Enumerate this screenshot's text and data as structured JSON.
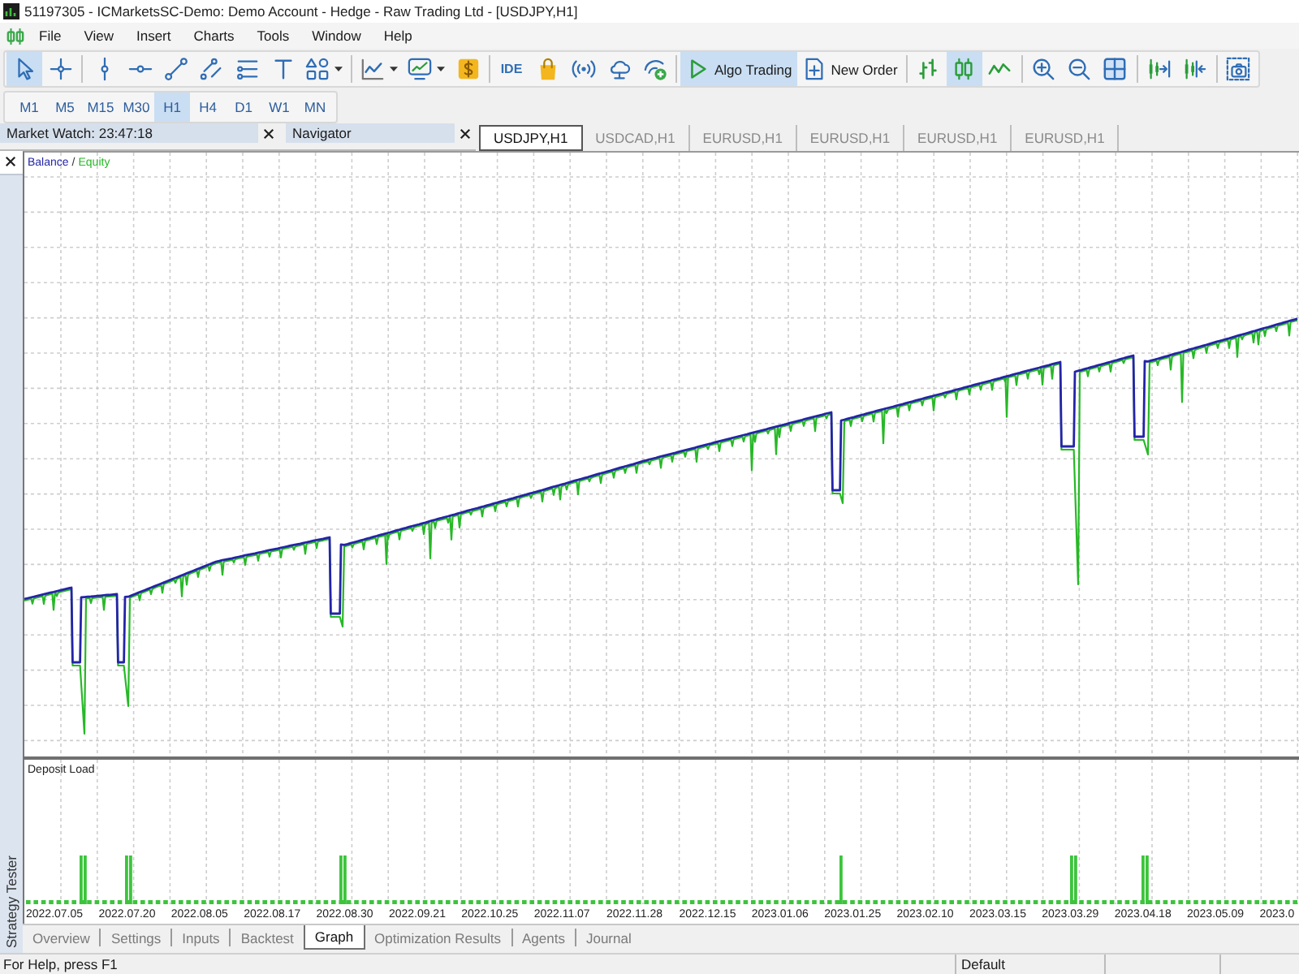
{
  "window": {
    "title": "51197305 - ICMarketsSC-Demo: Demo Account - Hedge - Raw Trading Ltd - [USDJPY,H1]"
  },
  "menu": [
    "File",
    "View",
    "Insert",
    "Charts",
    "Tools",
    "Window",
    "Help"
  ],
  "toolbar": [
    [
      {
        "kind": "icon",
        "on": true
      },
      {
        "kind": "icon",
        "on": false
      }
    ],
    [
      {
        "kind": "icon",
        "on": false
      },
      {
        "kind": "icon",
        "on": false
      },
      {
        "kind": "icon",
        "on": false
      },
      {
        "kind": "icon",
        "on": false
      },
      {
        "kind": "icon",
        "on": false
      },
      {
        "kind": "icon",
        "on": false
      },
      {
        "kind": "icon-menu",
        "on": false
      }
    ],
    [
      {
        "kind": "icon-menu",
        "on": false
      },
      {
        "kind": "icon-menu",
        "on": false
      },
      {
        "kind": "icon",
        "on": false
      }
    ],
    [
      {
        "kind": "text",
        "label": "IDE",
        "on": false
      },
      {
        "kind": "icon",
        "on": false
      },
      {
        "kind": "icon",
        "on": false
      },
      {
        "kind": "icon",
        "on": false
      },
      {
        "kind": "icon",
        "on": false
      }
    ],
    [
      {
        "kind": "icon-text",
        "label": "Algo Trading",
        "on": true
      },
      {
        "kind": "icon-text",
        "label": "New Order",
        "on": false
      }
    ],
    [
      {
        "kind": "icon",
        "on": false
      },
      {
        "kind": "icon",
        "on": true
      },
      {
        "kind": "icon",
        "on": false
      }
    ],
    [
      {
        "kind": "icon",
        "on": false
      },
      {
        "kind": "icon",
        "on": false
      },
      {
        "kind": "icon",
        "on": false
      }
    ],
    [
      {
        "kind": "icon",
        "on": false
      },
      {
        "kind": "icon",
        "on": false
      }
    ],
    [
      {
        "kind": "icon",
        "on": false
      }
    ]
  ],
  "timeframes": [
    {
      "label": "M1",
      "selected": false
    },
    {
      "label": "M5",
      "selected": false
    },
    {
      "label": "M15",
      "selected": false
    },
    {
      "label": "M30",
      "selected": false
    },
    {
      "label": "H1",
      "selected": true
    },
    {
      "label": "H4",
      "selected": false
    },
    {
      "label": "D1",
      "selected": false
    },
    {
      "label": "W1",
      "selected": false
    },
    {
      "label": "MN",
      "selected": false
    }
  ],
  "panels": [
    {
      "title": "Market Watch: 23:47:18"
    },
    {
      "title": "Navigator"
    }
  ],
  "chart_tabs": [
    {
      "label": "USDJPY,H1",
      "selected": true
    },
    {
      "label": "USDCAD,H1",
      "selected": false
    },
    {
      "label": "EURUSD,H1",
      "selected": false
    },
    {
      "label": "EURUSD,H1",
      "selected": false
    },
    {
      "label": "EURUSD,H1",
      "selected": false
    },
    {
      "label": "EURUSD,H1",
      "selected": false
    }
  ],
  "chart": {
    "legend": [
      {
        "label": "Balance",
        "color": "#2424a8"
      },
      {
        "label": "Equity",
        "color": "#27b827"
      }
    ],
    "legend_separator": "/",
    "lower_pane_title": "Deposit Load",
    "dates": [
      "2022.07.05",
      "2022.07.20",
      "2022.08.05",
      "2022.08.17",
      "2022.08.30",
      "2022.09.21",
      "2022.10.25",
      "2022.11.07",
      "2022.11.28",
      "2022.12.15",
      "2023.01.06",
      "2023.01.25",
      "2023.02.10",
      "2023.03.15",
      "2023.03.29",
      "2023.04.18",
      "2023.05.09",
      "2023.0"
    ]
  },
  "side_panel": {
    "title": "Strategy Tester"
  },
  "tester_tabs": [
    {
      "label": "Overview",
      "selected": false
    },
    {
      "label": "Settings",
      "selected": false
    },
    {
      "label": "Inputs",
      "selected": false
    },
    {
      "label": "Backtest",
      "selected": false
    },
    {
      "label": "Graph",
      "selected": true
    },
    {
      "label": "Optimization Results",
      "selected": false
    },
    {
      "label": "Agents",
      "selected": false
    },
    {
      "label": "Journal",
      "selected": false
    }
  ],
  "status_bar": [
    "For Help, press F1",
    "Default"
  ]
}
